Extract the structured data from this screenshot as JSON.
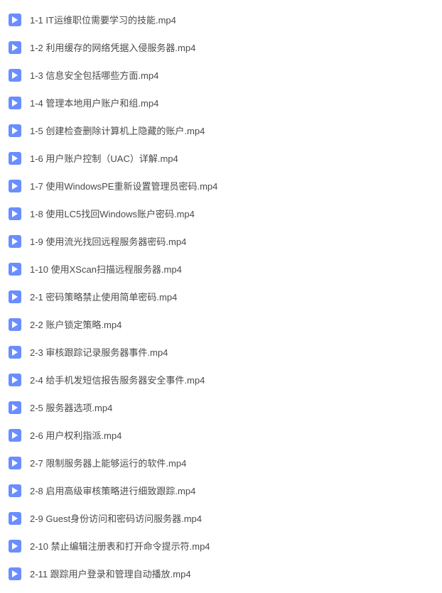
{
  "files": [
    {
      "name": "1-1 IT运维职位需要学习的技能.mp4"
    },
    {
      "name": "1-2 利用缓存的网络凭据入侵服务器.mp4"
    },
    {
      "name": "1-3 信息安全包括哪些方面.mp4"
    },
    {
      "name": "1-4 管理本地用户账户和组.mp4"
    },
    {
      "name": "1-5 创建检查删除计算机上隐藏的账户.mp4"
    },
    {
      "name": "1-6 用户账户控制（UAC）详解.mp4"
    },
    {
      "name": "1-7 使用WindowsPE重新设置管理员密码.mp4"
    },
    {
      "name": "1-8 使用LC5找回Windows账户密码.mp4"
    },
    {
      "name": "1-9 使用流光找回远程服务器密码.mp4"
    },
    {
      "name": "1-10 使用XScan扫描远程服务器.mp4"
    },
    {
      "name": "2-1 密码策略禁止使用简单密码.mp4"
    },
    {
      "name": "2-2 账户锁定策略.mp4"
    },
    {
      "name": "2-3 审核跟踪记录服务器事件.mp4"
    },
    {
      "name": "2-4 给手机发短信报告服务器安全事件.mp4"
    },
    {
      "name": "2-5 服务器选项.mp4"
    },
    {
      "name": "2-6 用户权利指派.mp4"
    },
    {
      "name": "2-7 限制服务器上能够运行的软件.mp4"
    },
    {
      "name": "2-8 启用高级审核策略进行细致跟踪.mp4"
    },
    {
      "name": "2-9 Guest身份访问和密码访问服务器.mp4"
    },
    {
      "name": "2-10 禁止编辑注册表和打开命令提示符.mp4"
    },
    {
      "name": "2-11 跟踪用户登录和管理自动播放.mp4"
    }
  ]
}
